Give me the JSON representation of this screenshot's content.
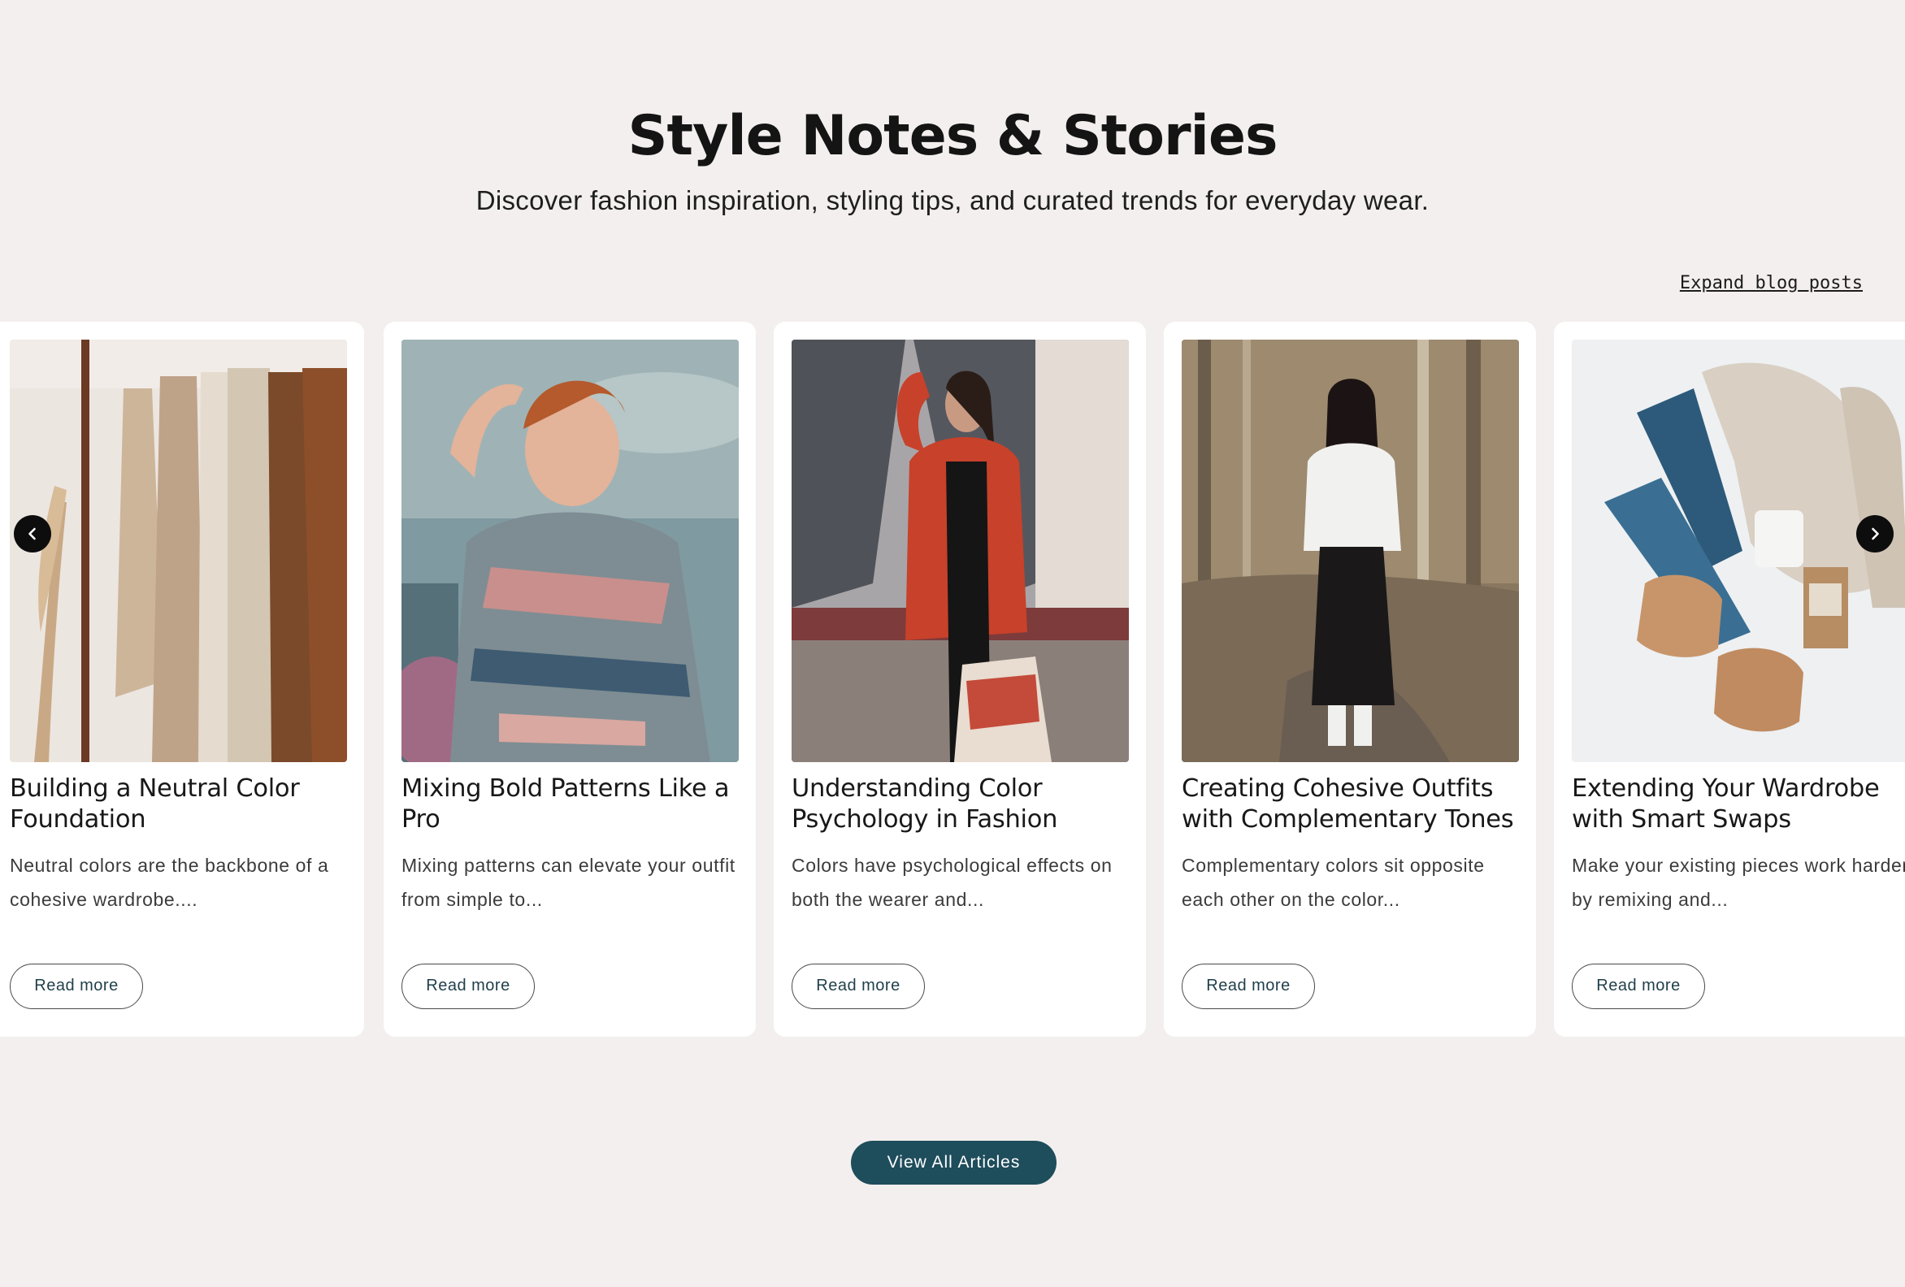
{
  "section": {
    "title": "Style Notes & Stories",
    "subtitle": "Discover fashion inspiration, styling tips, and curated trends for everyday wear."
  },
  "expand_link": "Expand blog posts",
  "cards": [
    {
      "title": "Building a Neutral Color Foundation",
      "excerpt": "Neutral colors are the backbone of a cohesive wardrobe....",
      "button": "Read more",
      "image": "clothes-rack-neutral-knits"
    },
    {
      "title": "Mixing Bold Patterns Like a Pro",
      "excerpt": "Mixing patterns can elevate your outfit from simple to...",
      "button": "Read more",
      "image": "woman-patterned-shirt"
    },
    {
      "title": "Understanding Color Psychology in Fashion",
      "excerpt": "Colors have psychological effects on both the wearer and...",
      "button": "Read more",
      "image": "woman-red-coat-shopping"
    },
    {
      "title": "Creating Cohesive Outfits with Complementary Tones",
      "excerpt": "Complementary colors sit opposite each other on the color...",
      "button": "Read more",
      "image": "woman-white-tee-black-skirt"
    },
    {
      "title": "Extending Your Wardrobe with Smart Swaps",
      "excerpt": "Make your existing pieces work harder by remixing and...",
      "button": "Read more",
      "image": "flatlay-jeans-sweater-boots"
    }
  ],
  "carousel": {
    "prev_icon": "chevron-left-icon",
    "next_icon": "chevron-right-icon"
  },
  "cta": {
    "label": "View All Articles"
  },
  "colors": {
    "background": "#f3efee",
    "card": "#ffffff",
    "accent": "#1e4d5c",
    "arrow": "#0d0d0d"
  }
}
